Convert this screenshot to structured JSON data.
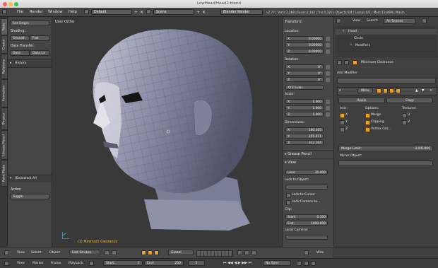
{
  "window": {
    "title": "LowHead/Head2.blend"
  },
  "info": {
    "menus": [
      "File",
      "Render",
      "Window",
      "Help"
    ],
    "screen": "Default",
    "scene": "Scene",
    "engine": "Blender Render",
    "stats": "v2.77 | Verts:2,268 | Faces:2,142 | Tris:4,320 | Objects:0/4 | Lamps:0/1 | Mem:13.86M | Minim"
  },
  "tool_tabs": [
    "Tools",
    "Create",
    "Relations",
    "Animation",
    "Physics",
    "Grease Pencil",
    "Paint Mode"
  ],
  "tool_panel": {
    "set_origin": "Set Origin",
    "shading_label": "Shading:",
    "smooth": "Smooth",
    "flat": "Flat",
    "data_transfer_label": "Data Transfer:",
    "data": "Data",
    "data_la": "Data La",
    "history": "History",
    "deselect_all": "(De)select All",
    "action_label": "Action",
    "action_value": "Toggle"
  },
  "viewport": {
    "view_label": "User Ortho",
    "object_label": "(1) Minimum Clearance"
  },
  "npanel": {
    "transform": "Transform",
    "location": "Location:",
    "loc": [
      {
        "axis": "X:",
        "val": "0.00000"
      },
      {
        "axis": "Y:",
        "val": "0.00000"
      },
      {
        "axis": "Z:",
        "val": "0.00000"
      }
    ],
    "rotation": "Rotation:",
    "rot": [
      {
        "axis": "X:",
        "val": "0°"
      },
      {
        "axis": "Y:",
        "val": "0°"
      },
      {
        "axis": "Z:",
        "val": "0°"
      }
    ],
    "rot_mode": "XYZ Euler",
    "scale": "Scale:",
    "scl": [
      {
        "axis": "X:",
        "val": "1.000"
      },
      {
        "axis": "Y:",
        "val": "1.000"
      },
      {
        "axis": "Z:",
        "val": "1.000"
      }
    ],
    "dimensions": "Dimensions:",
    "dim": [
      {
        "axis": "X:",
        "val": "180.305"
      },
      {
        "axis": "Y:",
        "val": "255.071"
      },
      {
        "axis": "Z:",
        "val": "312.194"
      }
    ],
    "grease_pencil": "Grease Pencil",
    "view": "View",
    "lens_label": "Lens:",
    "lens_val": "35.000",
    "lock_to_object": "Lock to Object:",
    "lock_to_cursor": "Lock to Cursor",
    "lock_camera_to": "Lock Camera to...",
    "clip": "Clip:",
    "clip_start_label": "Start:",
    "clip_start_val": "0.100",
    "clip_end_label": "End:",
    "clip_end_val": "1000.000",
    "local_camera": "Local Camera:"
  },
  "outliner": {
    "view": "View",
    "search": "Search",
    "scene_filter": "All Scenes",
    "items": [
      "Head",
      "Circle",
      "Modifiers"
    ]
  },
  "properties": {
    "object_name": "Minimum Clearance",
    "add_modifier": "Add Modifier",
    "modifier_name": "Mirro",
    "apply": "Apply",
    "copy": "Copy",
    "axis_label": "Axis:",
    "options_label": "Options:",
    "textures_label": "Textures:",
    "axes": [
      "X",
      "Y",
      "Z"
    ],
    "options": [
      "Merge",
      "Clipping",
      "Vertex Gro..."
    ],
    "tex": [
      "U",
      "V"
    ],
    "merge_limit_label": "Merge Limit:",
    "merge_limit_val": "0.001000",
    "mirror_object": "Mirror Object:"
  },
  "view_header": {
    "items": [
      "View",
      "Select",
      "Object",
      "Edit Strokes",
      "Global"
    ],
    "right": "Wire"
  },
  "timeline": {
    "items": [
      "View",
      "Marker",
      "Frame",
      "Playback"
    ],
    "start_label": "Start:",
    "start_val": "1",
    "end_label": "End:",
    "end_val": "250",
    "current": "1",
    "sync": "No Sync"
  },
  "colors": {
    "accent": "#f0a020",
    "panel": "#474747",
    "mesh": "#8a8ea6"
  }
}
